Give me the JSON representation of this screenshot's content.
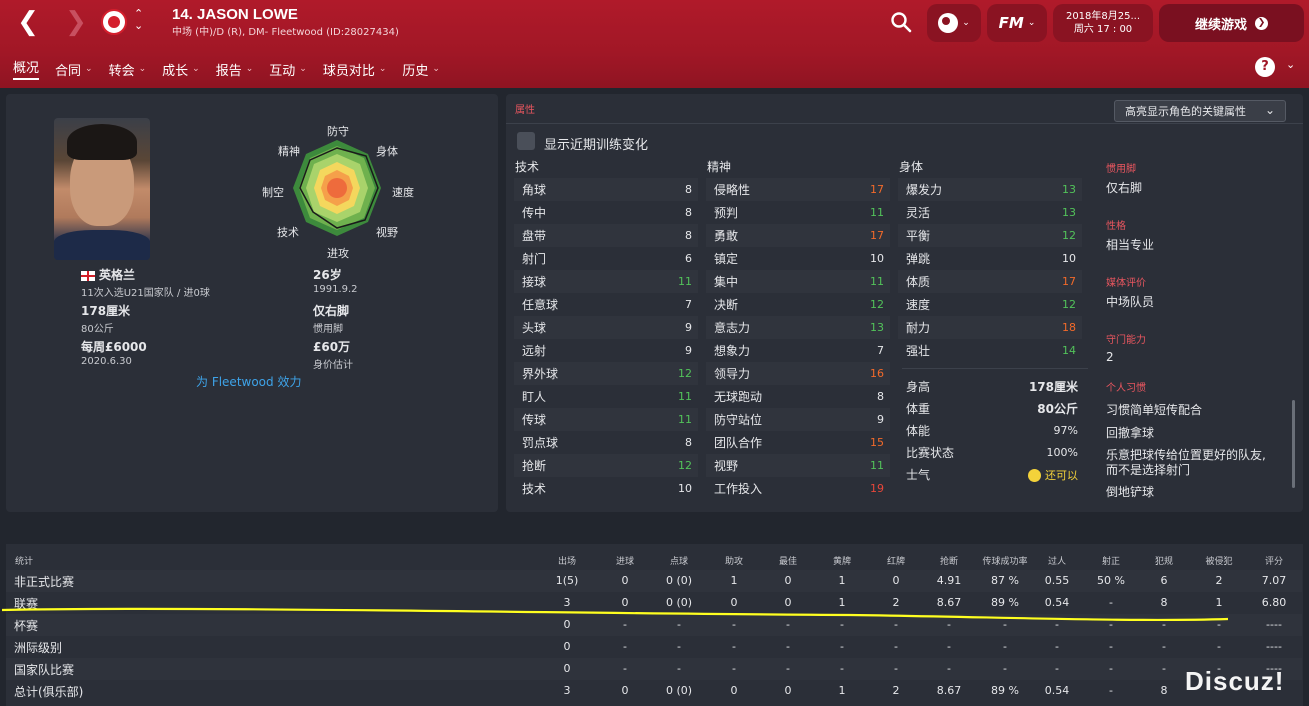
{
  "header": {
    "player_title": "14. JASON LOWE",
    "player_subtitle": "中场 (中)/D (R), DM- Fleetwood (ID:28027434)",
    "date_line1": "2018年8月25...",
    "date_line2": "周六 17 : 00",
    "continue_label": "继续游戏",
    "fm_label": "FM"
  },
  "menu": [
    {
      "label": "概况"
    },
    {
      "label": "合同"
    },
    {
      "label": "转会"
    },
    {
      "label": "成长"
    },
    {
      "label": "报告"
    },
    {
      "label": "互动"
    },
    {
      "label": "球员对比"
    },
    {
      "label": "历史"
    }
  ],
  "profile": {
    "nation": "英格兰",
    "caps": "11次入选U21国家队 / 进0球",
    "height": "178厘米",
    "weight": "80公斤",
    "wage": "每周£6000",
    "contract_end": "2020.6.30",
    "age": "26岁",
    "dob": "1991.9.2",
    "foot": "仅右脚",
    "foot_label": "惯用脚",
    "value": "£60万",
    "value_label": "身价估计",
    "plays_for": "为 Fleetwood 效力"
  },
  "radar": {
    "labels": {
      "defense": "防守",
      "physical": "身体",
      "speed": "速度",
      "vision": "视野",
      "attack": "进攻",
      "technique": "技术",
      "aerial": "制空",
      "mental": "精神"
    }
  },
  "attributes": {
    "section_label": "属性",
    "highlight_label": "高亮显示角色的关键属性",
    "training_label": "显示近期训练变化",
    "technical_header": "技术",
    "mental_header": "精神",
    "physical_header": "身体",
    "technical": [
      {
        "name": "角球",
        "value": "8",
        "color": "white"
      },
      {
        "name": "传中",
        "value": "8",
        "color": "white"
      },
      {
        "name": "盘带",
        "value": "8",
        "color": "white"
      },
      {
        "name": "射门",
        "value": "6",
        "color": "white"
      },
      {
        "name": "接球",
        "value": "11",
        "color": "green"
      },
      {
        "name": "任意球",
        "value": "7",
        "color": "white"
      },
      {
        "name": "头球",
        "value": "9",
        "color": "white"
      },
      {
        "name": "远射",
        "value": "9",
        "color": "white"
      },
      {
        "name": "界外球",
        "value": "12",
        "color": "green"
      },
      {
        "name": "盯人",
        "value": "11",
        "color": "green"
      },
      {
        "name": "传球",
        "value": "11",
        "color": "green"
      },
      {
        "name": "罚点球",
        "value": "8",
        "color": "white"
      },
      {
        "name": "抢断",
        "value": "12",
        "color": "green"
      },
      {
        "name": "技术",
        "value": "10",
        "color": "white"
      }
    ],
    "mental": [
      {
        "name": "侵略性",
        "value": "17",
        "color": "orange"
      },
      {
        "name": "预判",
        "value": "11",
        "color": "green"
      },
      {
        "name": "勇敢",
        "value": "17",
        "color": "orange"
      },
      {
        "name": "镇定",
        "value": "10",
        "color": "white"
      },
      {
        "name": "集中",
        "value": "11",
        "color": "green"
      },
      {
        "name": "决断",
        "value": "12",
        "color": "green"
      },
      {
        "name": "意志力",
        "value": "13",
        "color": "green"
      },
      {
        "name": "想象力",
        "value": "7",
        "color": "white"
      },
      {
        "name": "领导力",
        "value": "16",
        "color": "orange"
      },
      {
        "name": "无球跑动",
        "value": "8",
        "color": "white"
      },
      {
        "name": "防守站位",
        "value": "9",
        "color": "white"
      },
      {
        "name": "团队合作",
        "value": "15",
        "color": "orange"
      },
      {
        "name": "视野",
        "value": "11",
        "color": "green"
      },
      {
        "name": "工作投入",
        "value": "19",
        "color": "red"
      }
    ],
    "physical": [
      {
        "name": "爆发力",
        "value": "13",
        "color": "green"
      },
      {
        "name": "灵活",
        "value": "13",
        "color": "green"
      },
      {
        "name": "平衡",
        "value": "12",
        "color": "green"
      },
      {
        "name": "弹跳",
        "value": "10",
        "color": "white"
      },
      {
        "name": "体质",
        "value": "17",
        "color": "orange"
      },
      {
        "name": "速度",
        "value": "12",
        "color": "green"
      },
      {
        "name": "耐力",
        "value": "18",
        "color": "orange"
      },
      {
        "name": "强壮",
        "value": "14",
        "color": "green"
      }
    ],
    "info": [
      {
        "name": "身高",
        "value": "178厘米"
      },
      {
        "name": "体重",
        "value": "80公斤"
      },
      {
        "name": "体能",
        "value": "97%"
      },
      {
        "name": "比赛状态",
        "value": "100%"
      },
      {
        "name": "士气",
        "value": "还可以"
      }
    ]
  },
  "right_panel": {
    "foot_hd": "惯用脚",
    "foot_v": "仅右脚",
    "personality_hd": "性格",
    "personality_v": "相当专业",
    "media_hd": "媒体评价",
    "media_v": "中场队员",
    "gk_hd": "守门能力",
    "gk_v": "2",
    "traits_hd": "个人习惯",
    "traits": [
      "习惯简单短传配合",
      "回撤拿球",
      "乐意把球传给位置更好的队友,",
      "而不是选择射门",
      "倒地铲球"
    ]
  },
  "stats": {
    "title": "统计",
    "columns": [
      "出场",
      "进球",
      "点球",
      "助攻",
      "最佳",
      "黄牌",
      "红牌",
      "抢断",
      "传球成功率",
      "过人",
      "射正",
      "犯规",
      "被侵犯",
      "评分"
    ],
    "rows": [
      {
        "label": "非正式比赛",
        "cells": [
          "1(5)",
          "0",
          "0 (0)",
          "1",
          "0",
          "1",
          "0",
          "4.91",
          "87 %",
          "0.55",
          "50 %",
          "6",
          "2",
          "7.07"
        ]
      },
      {
        "label": "联赛",
        "cells": [
          "3",
          "0",
          "0 (0)",
          "0",
          "0",
          "1",
          "2",
          "8.67",
          "89 %",
          "0.54",
          "-",
          "8",
          "1",
          "6.80"
        ]
      },
      {
        "label": "杯赛",
        "cells": [
          "0",
          "-",
          "-",
          "-",
          "-",
          "-",
          "-",
          "-",
          "-",
          "-",
          "-",
          "-",
          "-",
          "----"
        ]
      },
      {
        "label": "洲际级别",
        "cells": [
          "0",
          "-",
          "-",
          "-",
          "-",
          "-",
          "-",
          "-",
          "-",
          "-",
          "-",
          "-",
          "-",
          "----"
        ]
      },
      {
        "label": "国家队比赛",
        "cells": [
          "0",
          "-",
          "-",
          "-",
          "-",
          "-",
          "-",
          "-",
          "-",
          "-",
          "-",
          "-",
          "-",
          "----"
        ]
      },
      {
        "label": "总计(俱乐部)",
        "cells": [
          "3",
          "0",
          "0 (0)",
          "0",
          "0",
          "1",
          "2",
          "8.67",
          "89 %",
          "0.54",
          "-",
          "8",
          "",
          ""
        ]
      }
    ]
  },
  "watermark": "Discuz!",
  "colors": {
    "header_red": "#a11726",
    "green": "#52c25a",
    "orange": "#f26a2a",
    "red": "#e8473a",
    "link_blue": "#3ea3e8"
  }
}
